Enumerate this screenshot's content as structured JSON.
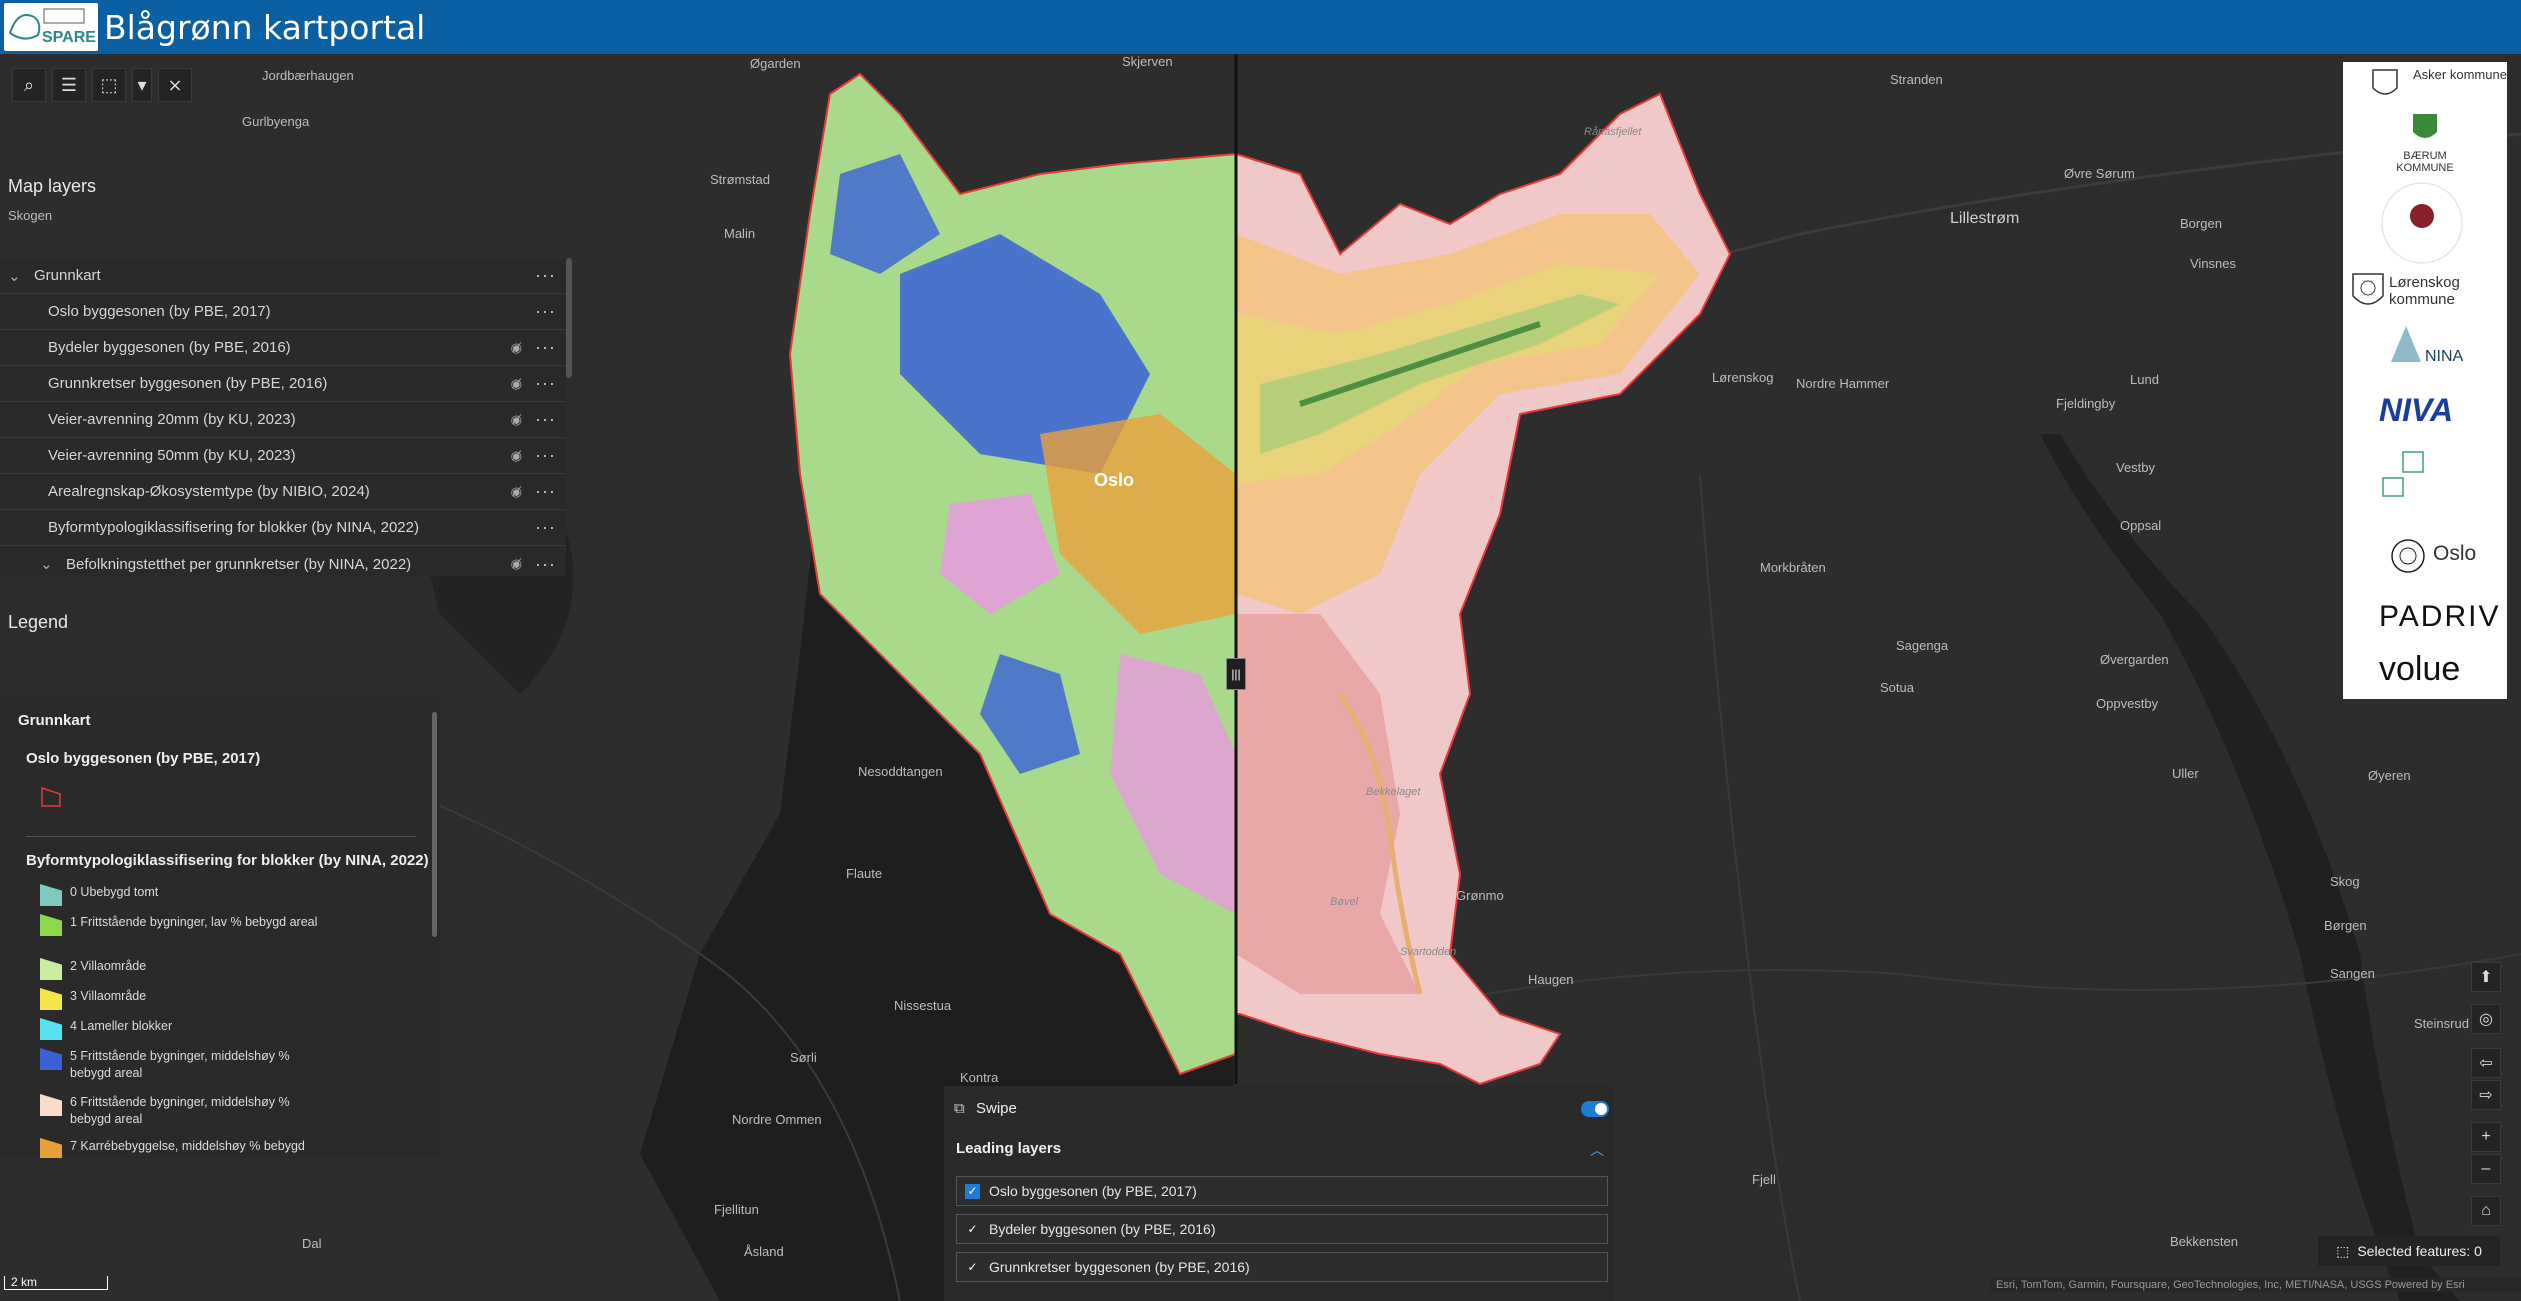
{
  "header": {
    "app_title": "Blågrønn kartportal",
    "logo_text": "SPARE"
  },
  "toolbar": {
    "tools": [
      "search-icon",
      "layer-list-icon",
      "select-icon",
      "chevron-down-icon",
      "clear-selection-icon"
    ]
  },
  "map_layers": {
    "title": "Map layers",
    "group": "Grunnkart",
    "items": [
      {
        "label": "Oslo byggesonen (by PBE, 2017)",
        "hidden": false
      },
      {
        "label": "Bydeler byggesonen (by PBE, 2016)",
        "hidden": true
      },
      {
        "label": "Grunnkretser byggesonen (by PBE, 2016)",
        "hidden": true
      },
      {
        "label": "Veier-avrenning 20mm (by KU, 2023)",
        "hidden": true
      },
      {
        "label": "Veier-avrenning 50mm (by KU, 2023)",
        "hidden": true
      },
      {
        "label": "Arealregnskap-Økosystemtype (by NIBIO, 2024)",
        "hidden": true
      },
      {
        "label": "Byformtypologiklassifisering for blokker (by NINA, 2022)",
        "hidden": false
      },
      {
        "label": "Befolkningstetthet per grunnkretser (by NINA, 2022)",
        "hidden": true
      }
    ]
  },
  "legend": {
    "title": "Legend",
    "group": "Grunnkart",
    "layer1": "Oslo byggesonen (by PBE, 2017)",
    "layer2": "Byformtypologiklassifisering for blokker (by NINA, 2022)",
    "items": [
      {
        "label": "0 Ubebygd tomt",
        "color": "#7fc8c0"
      },
      {
        "label": "1 Frittstående bygninger, lav % bebygd areal",
        "color": "#8fd64f"
      },
      {
        "label": "2 Villaområde",
        "color": "#c8eda0"
      },
      {
        "label": "3 Villaområde",
        "color": "#f5e34a"
      },
      {
        "label": "4 Lameller blokker",
        "color": "#56e0f0"
      },
      {
        "label": "5 Frittstående bygninger, middelshøy % bebygd areal",
        "color": "#3a62d6"
      },
      {
        "label": "6 Frittstående bygninger, middelshøy % bebygd areal",
        "color": "#f8dccc"
      },
      {
        "label": "7 Karrébebyggelse, middelshøy % bebygd",
        "color": "#e8a13a"
      }
    ]
  },
  "places": [
    "Jordbærhaugen",
    "Gurlbyenga",
    "Øgarden",
    "Skjerven",
    "Stranden",
    "Strømstad",
    "Malin",
    "Skogen",
    "Lillestrøm",
    "Øvre Sørum",
    "Borgen",
    "Vinsnes",
    "Lørenskog",
    "Nordre Hammer",
    "Fjeldingby",
    "Lund",
    "Vestby",
    "Oppsal",
    "Morkbråten",
    "Sagenga",
    "Sotua",
    "Øvergarden",
    "Oppvestby",
    "Uller",
    "Øyeren",
    "Nesoddtangen",
    "Flaute",
    "Grønmo",
    "Haugen",
    "Nissestua",
    "Sørli",
    "Kontra",
    "Nordre Ommen",
    "Fjellitun",
    "Åsland",
    "Dal",
    "Skog",
    "Børgen",
    "Sangen",
    "Steinsrud",
    "Fjell",
    "Bekkensten",
    "Oslo",
    "Rånåsfjellet",
    "Bekkelaget",
    "Bøvel",
    "Svartodden"
  ],
  "logos": [
    "Asker kommune",
    "BÆRUM KOMMUNE",
    "Lørenskog kommune",
    "NINA",
    "NIVA",
    "Oslo",
    "PADRIV",
    "volue"
  ],
  "nav": {
    "compass": "compass-icon",
    "locate": "locate-icon",
    "back": "back-icon",
    "forward": "forward-icon",
    "zoom_in": "+",
    "zoom_out": "–",
    "home": "home-icon"
  },
  "selected_features": "Selected features: 0",
  "scale": "2 km",
  "attribution": "Esri, TomTom, Garmin, Foursquare, GeoTechnologies, Inc, METI/NASA, USGS    Powered by Esri",
  "swipe": {
    "label": "Swipe",
    "enabled": true,
    "leading_label": "Leading layers",
    "layers": [
      {
        "label": "Oslo byggesonen (by PBE, 2017)",
        "checked": true
      },
      {
        "label": "Bydeler byggesonen (by PBE, 2016)",
        "checked": true
      },
      {
        "label": "Grunnkretser byggesonen (by PBE, 2016)",
        "checked": true
      }
    ],
    "handle_icon": "|||"
  }
}
